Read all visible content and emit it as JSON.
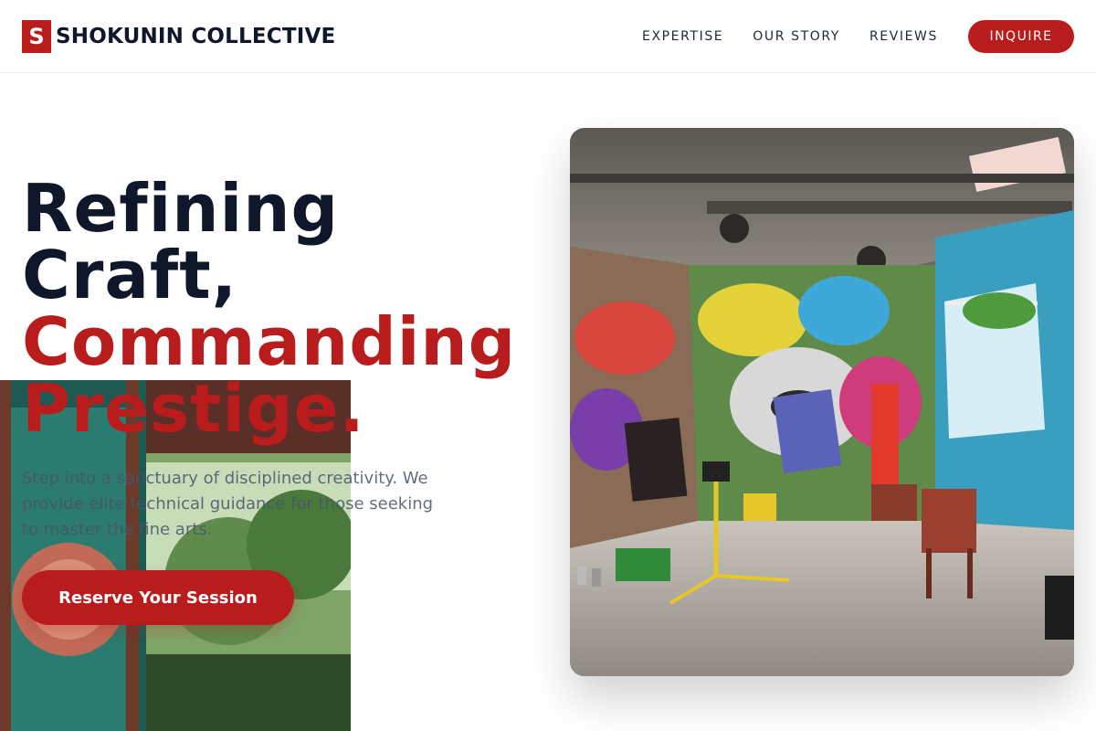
{
  "brand": {
    "mark": "S",
    "name": "SHOKUNIN COLLECTIVE"
  },
  "nav": {
    "links": [
      "EXPERTISE",
      "OUR STORY",
      "REVIEWS"
    ],
    "cta": "INQUIRE"
  },
  "hero": {
    "title_line1": "Refining",
    "title_line2": "Craft,",
    "title_line3": "Commanding",
    "title_line4": "Prestige.",
    "description": "Step into a sanctuary of disciplined creativity. We provide elite technical guidance for those seeking to master the fine arts.",
    "cta": "Reserve Your Session"
  },
  "colors": {
    "accent": "#b91c1c",
    "heading": "#0f172a",
    "body": "#475569"
  },
  "images": {
    "studio": "graffiti-art-studio-photo",
    "left": "outdoor-mural-photo"
  }
}
